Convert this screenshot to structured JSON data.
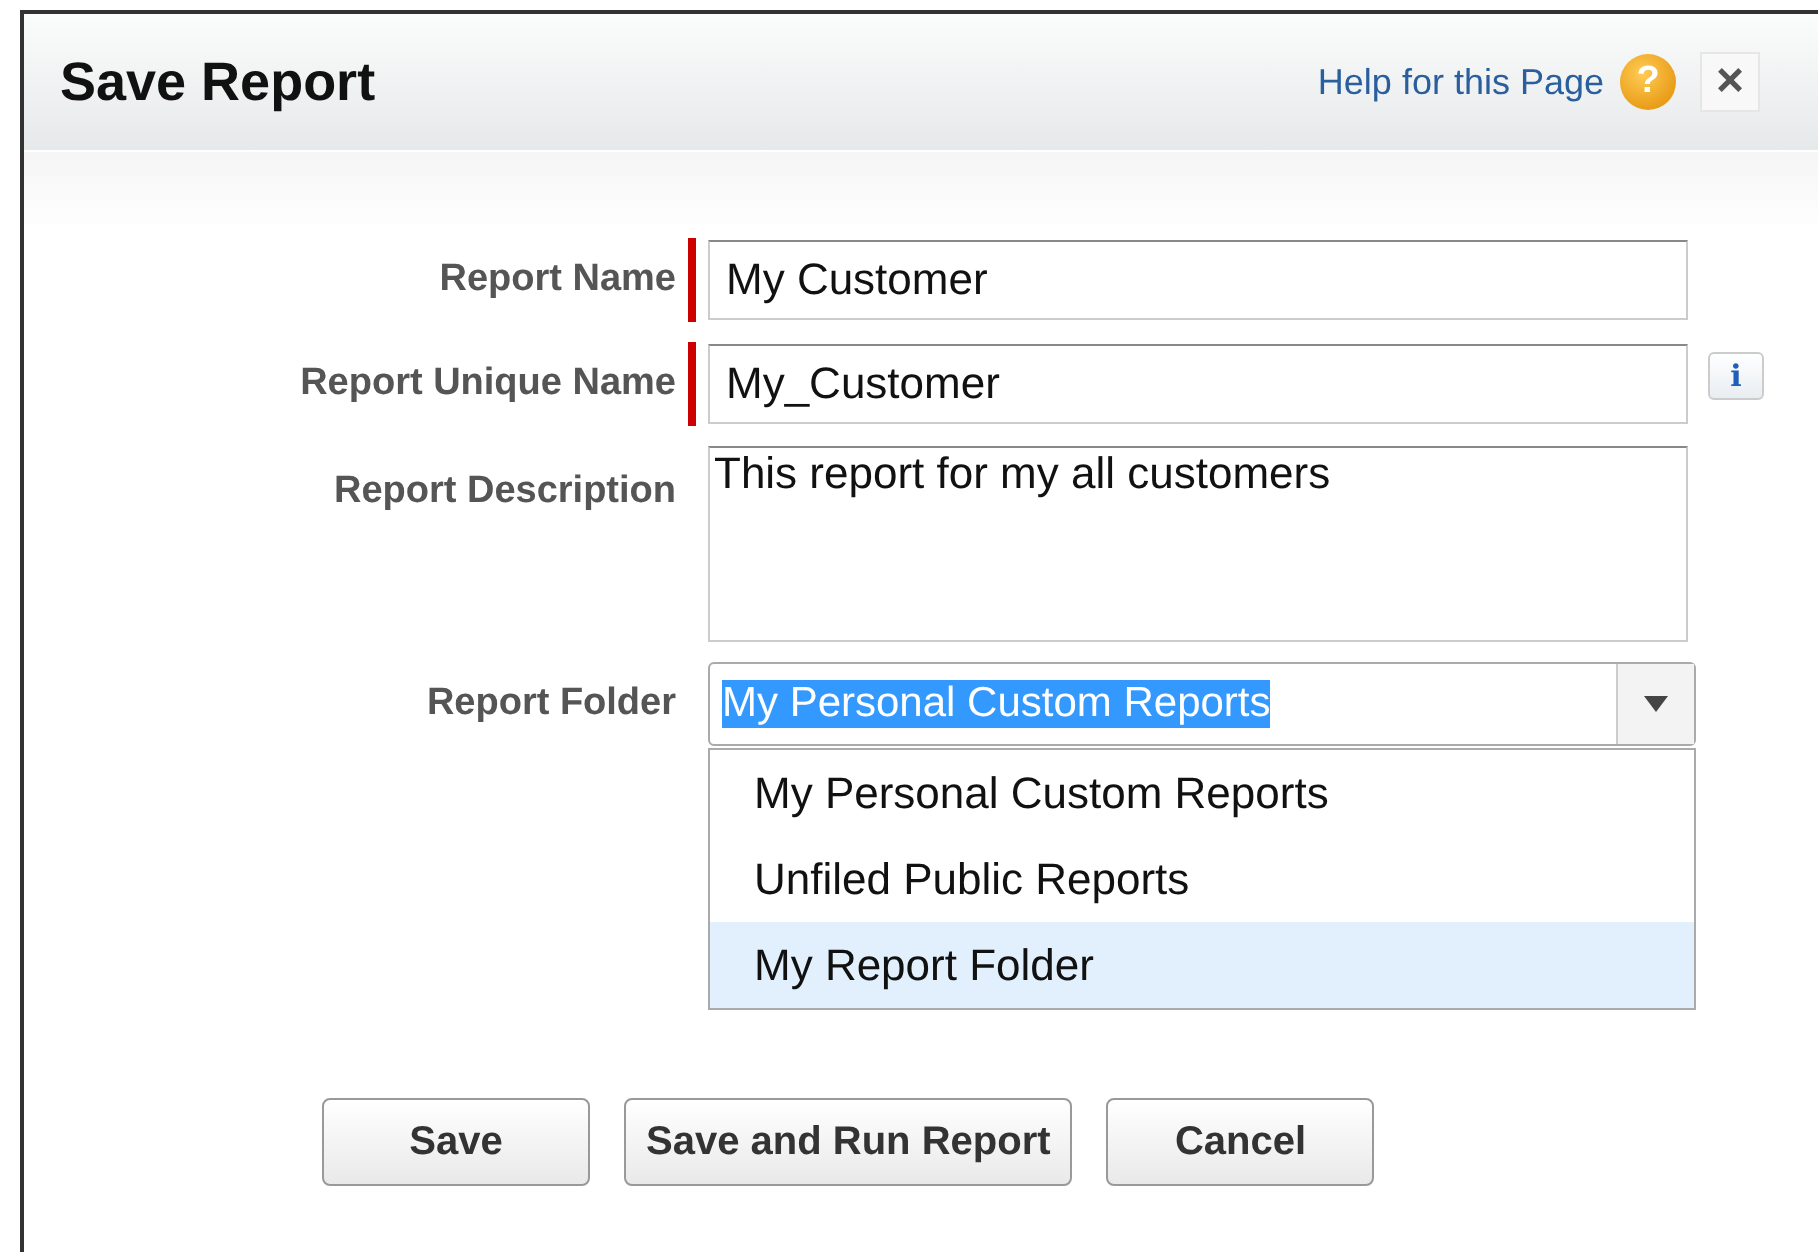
{
  "dialog": {
    "title": "Save Report",
    "help_link": "Help for this Page",
    "help_icon": "?",
    "close_icon": "×"
  },
  "fields": [
    {
      "kind": "text",
      "label": "Report Name",
      "required": true,
      "value": "My Customer"
    },
    {
      "kind": "text",
      "label": "Report Unique Name",
      "required": true,
      "value": "My_Customer",
      "info_icon": "i"
    },
    {
      "kind": "textarea",
      "label": "Report Description",
      "required": false,
      "value": "This report for my all customers"
    },
    {
      "kind": "select",
      "label": "Report Folder",
      "required": false,
      "value": "My Personal Custom Reports",
      "expanded": true,
      "options": [
        {
          "label": "My Personal Custom Reports",
          "highlighted": false
        },
        {
          "label": "Unfiled Public Reports",
          "highlighted": false
        },
        {
          "label": "My Report Folder",
          "highlighted": true
        }
      ]
    }
  ],
  "buttons": [
    "Save",
    "Save and Run Report",
    "Cancel"
  ]
}
